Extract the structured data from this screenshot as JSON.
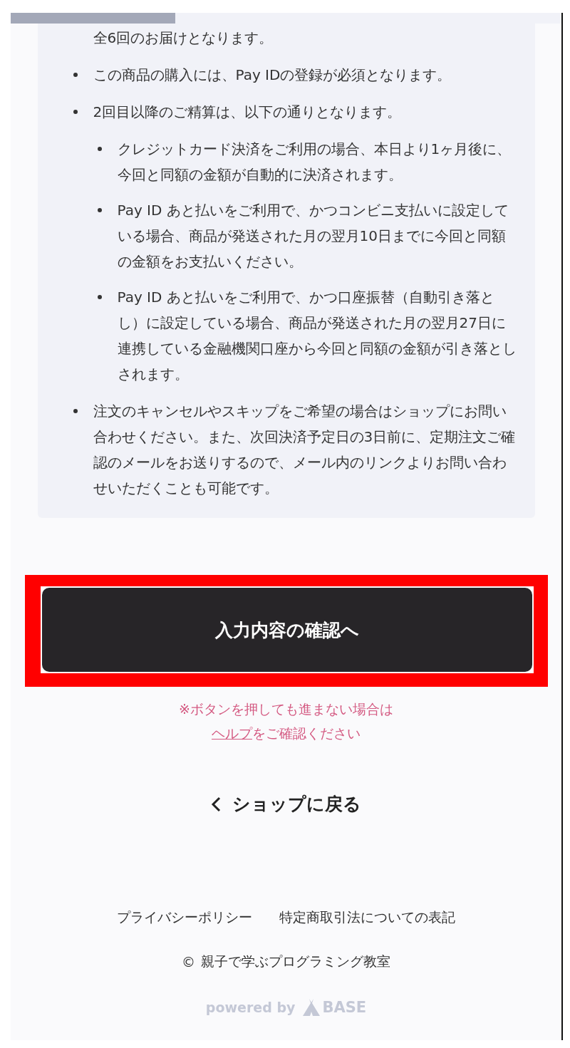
{
  "notes": [
    {
      "kind": "continuation",
      "text": "全6回のお届けとなります。"
    },
    {
      "kind": "bullet",
      "text": "この商品の購入には、Pay IDの登録が必須となります。"
    },
    {
      "kind": "bullet",
      "text": "2回目以降のご精算は、以下の通りとなります。",
      "children": [
        {
          "kind": "bullet",
          "text": "クレジットカード決済をご利用の場合、本日より1ヶ月後に、今回と同額の金額が自動的に決済されます。"
        },
        {
          "kind": "bullet",
          "text": "Pay ID あと払いをご利用で、かつコンビニ支払いに設定している場合、商品が発送された月の翌月10日までに今回と同額の金額をお支払いください。"
        },
        {
          "kind": "bullet",
          "text": "Pay ID あと払いをご利用で、かつ口座振替（自動引き落とし）に設定している場合、商品が発送された月の翌月27日に連携している金融機関口座から今回と同額の金額が引き落としされます。"
        }
      ]
    },
    {
      "kind": "bullet",
      "text": "注文のキャンセルやスキップをご希望の場合はショップにお問い合わせください。また、次回決済予定日の3日前に、定期注文ご確認のメールをお送りするので、メール内のリンクよりお問い合わせいただくことも可能です。"
    }
  ],
  "confirm_button": {
    "label": "入力内容の確認へ",
    "highlighted": true
  },
  "help_note": {
    "before": "※ボタンを押しても進まない場合は",
    "link": "ヘルプ",
    "after": "をご確認ください"
  },
  "back_link": {
    "label": "ショップに戻る"
  },
  "footer": {
    "links": [
      "プライバシーポリシー",
      "特定商取引法についての表記"
    ],
    "copyright_symbol": "©",
    "copyright": "親子で学ぶプログラミング教室",
    "powered_by": "powered by",
    "brand": "BASE"
  }
}
